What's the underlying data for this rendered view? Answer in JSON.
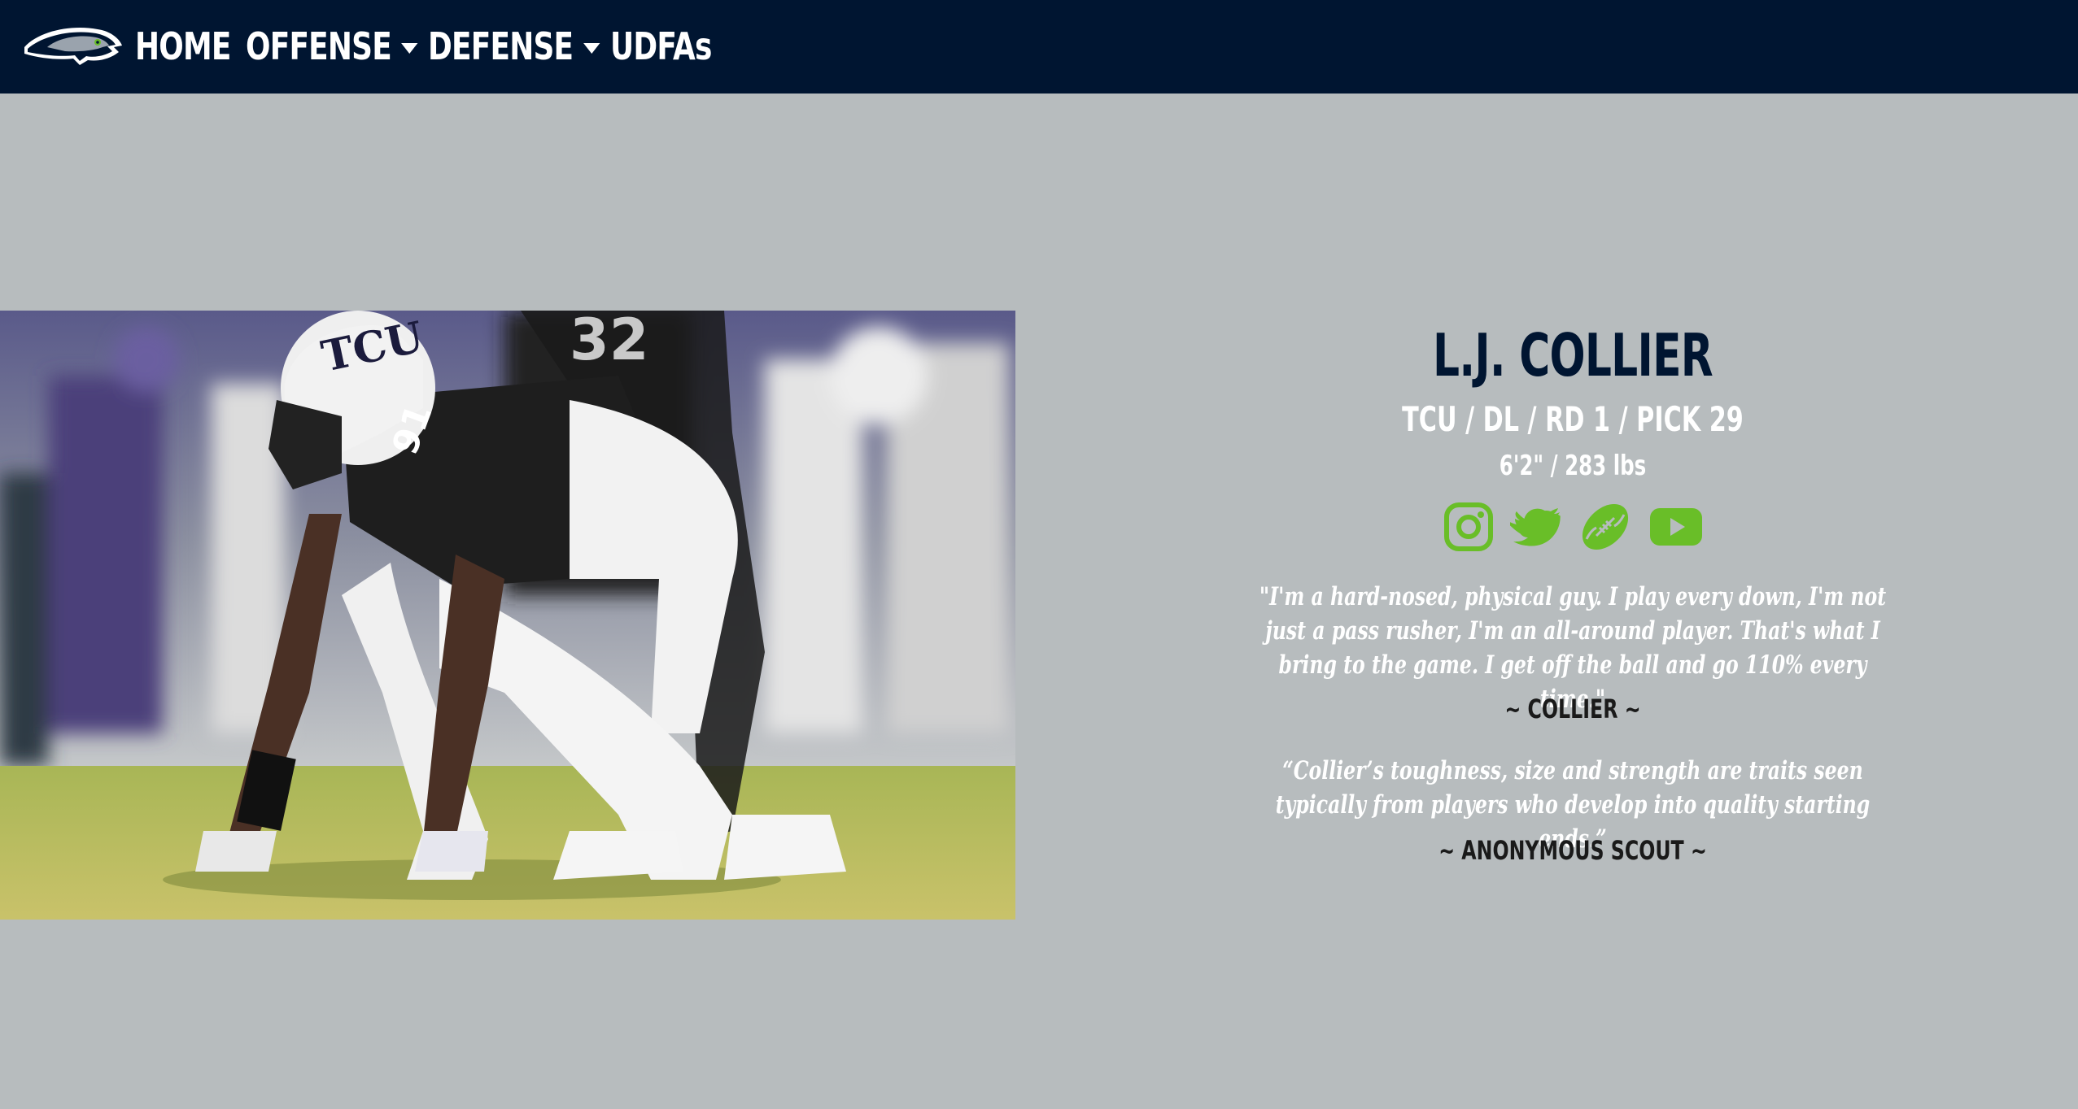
{
  "nav": {
    "logo_icon": "seahawks-logo-icon",
    "items": [
      {
        "label": "HOME",
        "has_caret": false
      },
      {
        "label": "OFFENSE",
        "has_caret": true
      },
      {
        "label": "DEFENSE",
        "has_caret": true
      },
      {
        "label": "UDFAs",
        "has_caret": false
      }
    ]
  },
  "player": {
    "name": "L.J. COLLIER",
    "subtitle": "TCU / DL / RD 1 / PICK 29",
    "measurements": "6'2\" / 283 lbs",
    "socials": [
      "instagram-icon",
      "twitter-icon",
      "football-icon",
      "youtube-icon"
    ],
    "quotes": [
      {
        "text": "\"I'm a hard-nosed, physical guy. I play every down, I'm not just a pass rusher, I'm an all-around player. That's what I bring to the game. I get off the ball and go 110% every time.\"",
        "attribution": "~ COLLIER ~"
      },
      {
        "text": "“Collier’s toughness, size and strength are traits seen typically from players who develop into quality starting ends.”",
        "attribution": "~ ANONYMOUS SCOUT ~"
      }
    ]
  },
  "colors": {
    "navy": "#001531",
    "accent_green": "#69be28",
    "background": "#b7bcbe"
  }
}
